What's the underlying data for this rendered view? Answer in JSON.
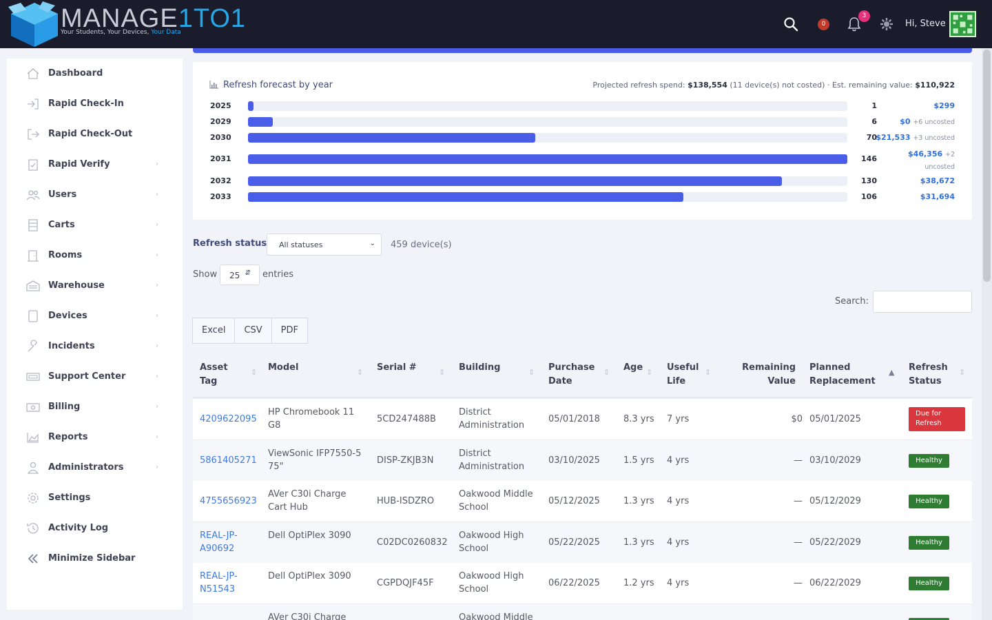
{
  "header": {
    "brand_part1": "MANAGE",
    "brand_part2": "1TO1",
    "tagline_main": "Your Students, Your Devices, ",
    "tagline_highlight": "Your Data",
    "cart_count": "0",
    "notifications_count": "3",
    "greeting": "Hi,  Steve",
    "brand_color": "#26a7e8"
  },
  "sidebar": {
    "items": [
      {
        "label": "Dashboard",
        "icon": "home-icon",
        "chevron": false
      },
      {
        "label": "Rapid Check-In",
        "icon": "sign-in-icon",
        "chevron": false
      },
      {
        "label": "Rapid Check-Out",
        "icon": "sign-out-icon",
        "chevron": false
      },
      {
        "label": "Rapid Verify",
        "icon": "clipboard-check-icon",
        "chevron": true
      },
      {
        "label": "Users",
        "icon": "users-icon",
        "chevron": true
      },
      {
        "label": "Carts",
        "icon": "cart-icon",
        "chevron": true
      },
      {
        "label": "Rooms",
        "icon": "door-icon",
        "chevron": true
      },
      {
        "label": "Warehouse",
        "icon": "warehouse-icon",
        "chevron": true
      },
      {
        "label": "Devices",
        "icon": "tablet-icon",
        "chevron": true
      },
      {
        "label": "Incidents",
        "icon": "wrench-icon",
        "chevron": true
      },
      {
        "label": "Support Center",
        "icon": "ticket-icon",
        "chevron": true
      },
      {
        "label": "Billing",
        "icon": "money-icon",
        "chevron": true
      },
      {
        "label": "Reports",
        "icon": "chart-area-icon",
        "chevron": true
      },
      {
        "label": "Administrators",
        "icon": "user-tie-icon",
        "chevron": true
      },
      {
        "label": "Settings",
        "icon": "gear-icon",
        "chevron": false
      },
      {
        "label": "Activity Log",
        "icon": "history-icon",
        "chevron": false
      },
      {
        "label": "Minimize Sidebar",
        "icon": "double-chevron-left-icon",
        "chevron": false
      }
    ]
  },
  "forecast": {
    "title": "Refresh forecast by year",
    "summary_prefix": "Projected refresh spend: ",
    "summary_spend": "$138,554",
    "summary_middle": " (11 device(s) not costed) · Est. remaining value: ",
    "summary_remaining": "$110,922",
    "max_count": 146,
    "rows": [
      {
        "year": "2025",
        "count": 1,
        "cost": "$299",
        "uncosted": ""
      },
      {
        "year": "2029",
        "count": 6,
        "cost": "$0",
        "uncosted": "+6 uncosted"
      },
      {
        "year": "2030",
        "count": 70,
        "cost": "$21,533",
        "uncosted": "+3 uncosted"
      },
      {
        "year": "2031",
        "count": 146,
        "cost": "$46,356",
        "uncosted": "+2 uncosted"
      },
      {
        "year": "2032",
        "count": 130,
        "cost": "$38,672",
        "uncosted": ""
      },
      {
        "year": "2033",
        "count": 106,
        "cost": "$31,694",
        "uncosted": ""
      }
    ],
    "bar_color": "#4a5de8"
  },
  "filters": {
    "status_label": "Refresh status:",
    "status_value": "All statuses",
    "device_count": "459 device(s)",
    "show_label": "Show",
    "show_value": "25",
    "entries_label": "entries",
    "search_label": "Search:",
    "search_value": ""
  },
  "exports": [
    "Excel",
    "CSV",
    "PDF"
  ],
  "table": {
    "headers": [
      "Asset Tag",
      "Model",
      "Serial #",
      "Building",
      "Purchase Date",
      "Age",
      "Useful Life",
      "Remaining Value",
      "Planned Replacement",
      "Refresh Status"
    ],
    "rows": [
      {
        "asset": "4209622095",
        "model": "HP Chromebook 11 G8",
        "serial": "5CD247488B",
        "building": "District Administration",
        "purchase": "05/01/2018",
        "age": "8.3 yrs",
        "life": "7 yrs",
        "remaining": "$0",
        "planned": "05/01/2025",
        "status": "Due for Refresh",
        "status_kind": "due"
      },
      {
        "asset": "5861405271",
        "model": "ViewSonic IFP7550-5 75\"",
        "serial": "DISP-ZKJB3N",
        "building": "District Administration",
        "purchase": "03/10/2025",
        "age": "1.5 yrs",
        "life": "4 yrs",
        "remaining": "—",
        "planned": "03/10/2029",
        "status": "Healthy",
        "status_kind": "ok"
      },
      {
        "asset": "4755656923",
        "model": "AVer C30i Charge Cart Hub",
        "serial": "HUB-ISDZRO",
        "building": "Oakwood Middle School",
        "purchase": "05/12/2025",
        "age": "1.3 yrs",
        "life": "4 yrs",
        "remaining": "—",
        "planned": "05/12/2029",
        "status": "Healthy",
        "status_kind": "ok"
      },
      {
        "asset": "REAL-JP-A90692",
        "model": "Dell OptiPlex 3090",
        "serial": "C02DC0260832",
        "building": "Oakwood High School",
        "purchase": "05/22/2025",
        "age": "1.3 yrs",
        "life": "4 yrs",
        "remaining": "—",
        "planned": "05/22/2029",
        "status": "Healthy",
        "status_kind": "ok"
      },
      {
        "asset": "REAL-JP-N51543",
        "model": "Dell OptiPlex 3090",
        "serial": "CGPDQJF45F",
        "building": "Oakwood High School",
        "purchase": "06/22/2025",
        "age": "1.2 yrs",
        "life": "4 yrs",
        "remaining": "—",
        "planned": "06/22/2029",
        "status": "Healthy",
        "status_kind": "ok"
      },
      {
        "asset": "",
        "model": "AVer C30i Charge",
        "serial": "",
        "building": "Oakwood Middle",
        "purchase": "",
        "age": "",
        "life": "",
        "remaining": "",
        "planned": "",
        "status": "Healthy",
        "status_kind": "ok"
      }
    ]
  }
}
